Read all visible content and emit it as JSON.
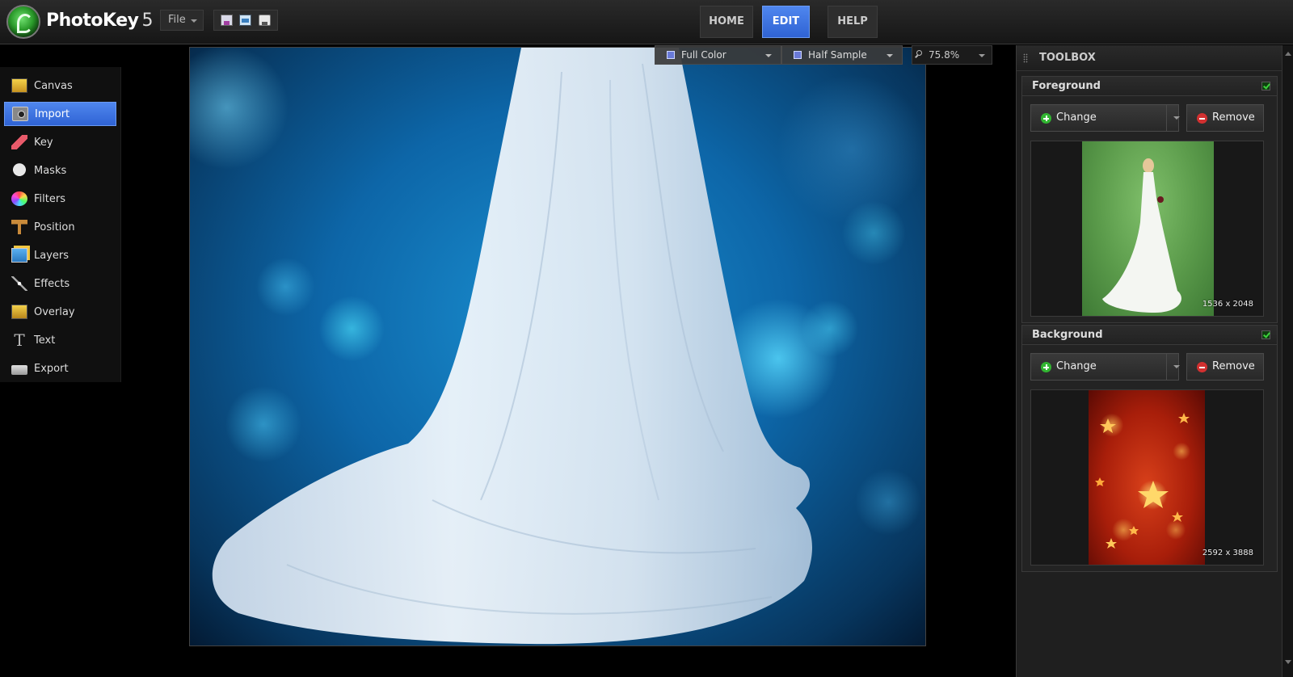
{
  "app": {
    "name": "PhotoKey",
    "version": "5"
  },
  "menu": {
    "file_label": "File"
  },
  "nav": {
    "home": "HOME",
    "edit": "EDIT",
    "help": "HELP",
    "active": "EDIT"
  },
  "sidebar": {
    "items": [
      {
        "label": "Canvas",
        "icon": "canvas-icon"
      },
      {
        "label": "Import",
        "icon": "camera-icon",
        "active": true
      },
      {
        "label": "Key",
        "icon": "eraser-icon"
      },
      {
        "label": "Masks",
        "icon": "mask-icon"
      },
      {
        "label": "Filters",
        "icon": "color-wheel-icon"
      },
      {
        "label": "Position",
        "icon": "crop-icon"
      },
      {
        "label": "Layers",
        "icon": "layers-icon"
      },
      {
        "label": "Effects",
        "icon": "magic-wand-icon"
      },
      {
        "label": "Overlay",
        "icon": "overlay-icon"
      },
      {
        "label": "Text",
        "icon": "text-icon"
      },
      {
        "label": "Export",
        "icon": "export-icon"
      }
    ]
  },
  "view": {
    "color_mode": "Full Color",
    "sample_mode": "Half Sample",
    "zoom": "75.8%"
  },
  "toolbox": {
    "title": "TOOLBOX",
    "foreground": {
      "title": "Foreground",
      "checked": true,
      "change_label": "Change",
      "remove_label": "Remove",
      "dimensions": "1536 x 2048"
    },
    "background": {
      "title": "Background",
      "checked": true,
      "change_label": "Change",
      "remove_label": "Remove",
      "dimensions": "2592 x 3888"
    }
  },
  "colors": {
    "accent": "#3f74e0",
    "panel": "#232323",
    "add_green": "#31b531",
    "remove_red": "#d23030"
  }
}
